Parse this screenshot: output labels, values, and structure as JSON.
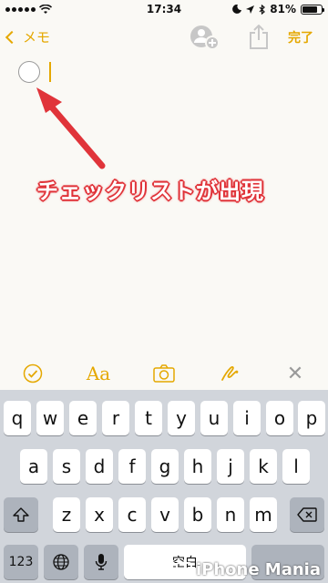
{
  "status_bar": {
    "time": "17:34",
    "battery": "81%",
    "battery_level": 0.81
  },
  "nav": {
    "back_label": "メモ",
    "done_label": "完了"
  },
  "annotation": {
    "text": "チェックリストが出現"
  },
  "format_toolbar": {
    "aa_label": "Aa",
    "close_label": "✕"
  },
  "keyboard": {
    "row1": [
      "q",
      "w",
      "e",
      "r",
      "t",
      "y",
      "u",
      "i",
      "o",
      "p"
    ],
    "row2": [
      "a",
      "s",
      "d",
      "f",
      "g",
      "h",
      "j",
      "k",
      "l"
    ],
    "row3": [
      "z",
      "x",
      "c",
      "v",
      "b",
      "n",
      "m"
    ],
    "numbers_label": "123",
    "space_label": "空白"
  },
  "watermark": {
    "text": "iPhone Mania"
  },
  "colors": {
    "accent": "#e5a800",
    "annotation_red": "#e0343a"
  }
}
